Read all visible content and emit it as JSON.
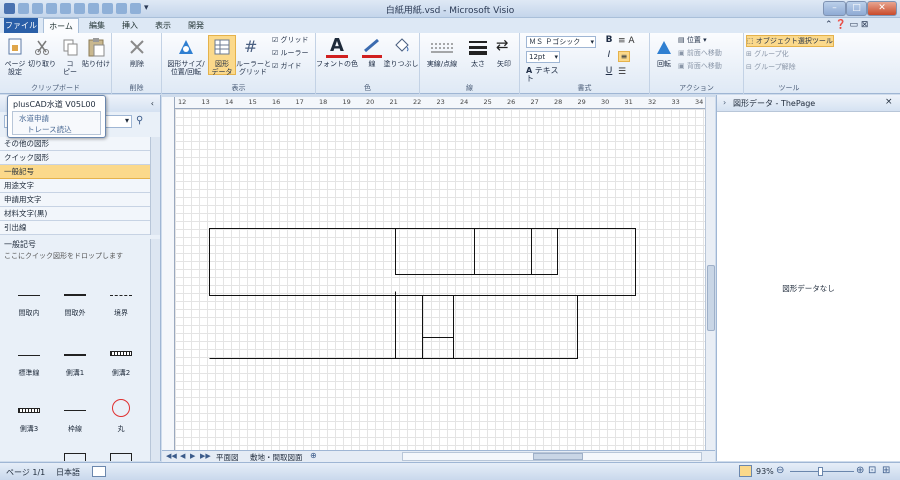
{
  "window": {
    "title": "白紙用紙.vsd - Microsoft Visio",
    "minimize": "–",
    "maximize": "□",
    "close": "✕"
  },
  "tabs": [
    "ファイル",
    "ホーム",
    "編集",
    "挿入",
    "表示",
    "開発"
  ],
  "ribbon": {
    "clipboard": {
      "page_setup": "ページ\n設定",
      "cut": "切り取り",
      "copy": "コ\nピー",
      "paste": "貼り付け",
      "label": "クリップボード"
    },
    "delete": {
      "button": "削除",
      "label": "削除"
    },
    "display": {
      "size_position": "図形サイズ/\n位置/回転",
      "shape_data": "図形\nデータ",
      "ruler_grid": "ルーラーと\nグリッド",
      "grid": "グリッド",
      "ruler": "ルーラー",
      "guide": "ガイド",
      "label": "表示"
    },
    "color": {
      "font_color": "フォントの色",
      "line": "線",
      "fill": "塗りつぶし",
      "label": "色"
    },
    "line": {
      "pattern": "実線/点線",
      "weight": "太さ",
      "arrow": "矢印",
      "label": "線"
    },
    "font": {
      "name": "ＭＳ Ｐゴシック",
      "size": "12pt",
      "text": "テキスト",
      "bold": "B",
      "italic": "I",
      "underline": "U",
      "label": "書式"
    },
    "action": {
      "rotate": "回転",
      "position": "位置",
      "bring_front": "前面へ移動",
      "send_back": "背面へ移動",
      "label": "アクション"
    },
    "tools": {
      "select": "オブジェクト選択ツール",
      "group": "グループ化",
      "ungroup": "グループ解除",
      "label": "ツール"
    }
  },
  "popup": {
    "title": "plusCAD水道 V05L00",
    "items": [
      "水道申請",
      "トレース読込"
    ]
  },
  "left_panel": {
    "categories": [
      "その他の図形",
      "クイック図形",
      "一般記号",
      "用途文字",
      "申請用文字",
      "材料文字(黒)",
      "引出線"
    ],
    "selected": "一般記号",
    "section_title": "一般記号",
    "hint": "ここにクイック図形をドロップします",
    "stencils": [
      "間取内",
      "間取外",
      "境界",
      "標準線",
      "側溝1",
      "側溝2",
      "側溝3",
      "枠線",
      "丸"
    ]
  },
  "canvas": {
    "ruler_numbers": [
      "12",
      "13",
      "14",
      "15",
      "16",
      "17",
      "18",
      "19",
      "20",
      "21",
      "22",
      "23",
      "24",
      "25",
      "26",
      "27",
      "28",
      "29",
      "30",
      "31",
      "32",
      "33",
      "34"
    ],
    "sheet_tabs": [
      "平面図",
      "敷地・間取図面"
    ],
    "nav": [
      "◀◀",
      "◀",
      "▶",
      "▶▶"
    ]
  },
  "right_panel": {
    "title": "図形データ - ThePage",
    "empty": "図形データなし",
    "close": "×"
  },
  "status": {
    "page": "ページ 1/1",
    "language": "日本語",
    "zoom": "93%"
  }
}
